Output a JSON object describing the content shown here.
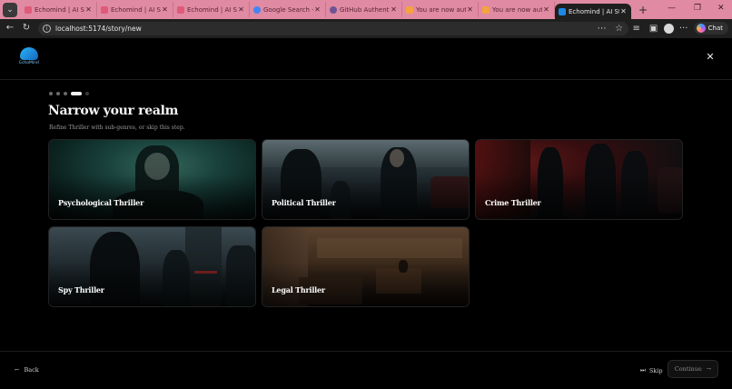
{
  "browser": {
    "tabs": [
      {
        "title": "Echomind | AI Story",
        "favicon_color": "#e05a7a"
      },
      {
        "title": "Echomind | AI Story",
        "favicon_color": "#e05a7a"
      },
      {
        "title": "Echomind | AI Story",
        "favicon_color": "#e05a7a"
      },
      {
        "title": "Google Search - Tu",
        "favicon_color": "#4285f4"
      },
      {
        "title": "GitHub Authenticat",
        "favicon_color": "#6e5494"
      },
      {
        "title": "You are now authe",
        "favicon_color": "#f4a340"
      },
      {
        "title": "You are now authe",
        "favicon_color": "#f4a340"
      }
    ],
    "active_tab": {
      "title": "Echomind | AI Story",
      "favicon_color": "#1e88e5"
    },
    "url": "localhost:5174/story/new",
    "chat_label": "Chat"
  },
  "app": {
    "logo_text": "EchoMind",
    "step_count": 5,
    "current_step": 4,
    "title": "Narrow your realm",
    "subtitle": "Refine Thriller with sub-genres, or skip this step.",
    "genres": [
      {
        "label": "Psychological Thriller",
        "theme": "teal"
      },
      {
        "label": "Political Thriller",
        "theme": "slate"
      },
      {
        "label": "Crime Thriller",
        "theme": "red"
      },
      {
        "label": "Spy Thriller",
        "theme": "steel"
      },
      {
        "label": "Legal Thriller",
        "theme": "amber"
      }
    ],
    "footer": {
      "back_label": "Back",
      "skip_label": "Skip",
      "continue_label": "Continue"
    }
  }
}
